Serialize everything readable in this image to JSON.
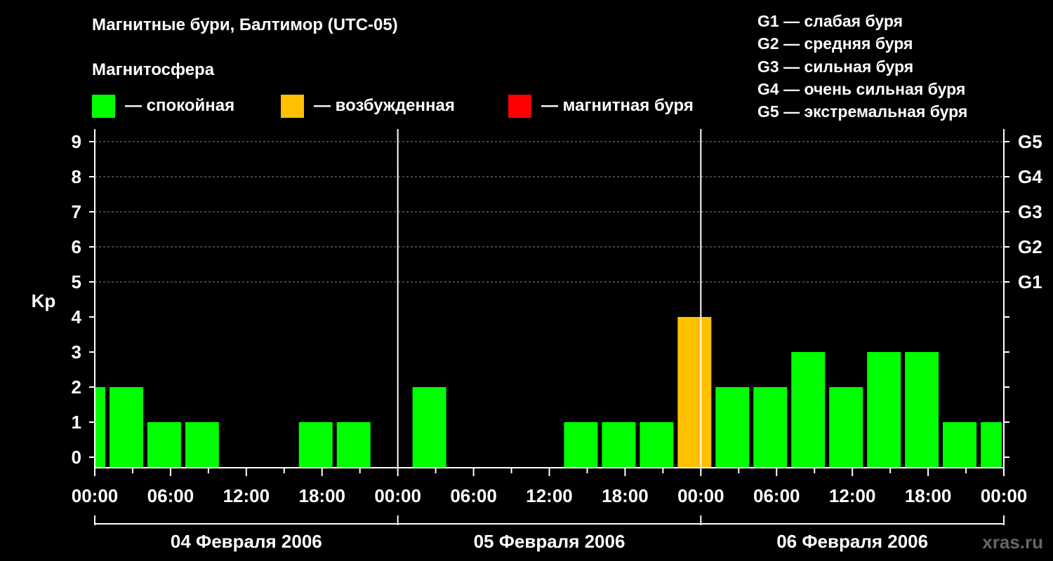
{
  "header": {
    "title": "Магнитные бури, Балтимор (UTC-05)",
    "subtitle": "Магнитосфера"
  },
  "legend": [
    {
      "label": "— спокойная",
      "color": "#00ff00"
    },
    {
      "label": "— возбужденная",
      "color": "#ffc000"
    },
    {
      "label": "— магнитная буря",
      "color": "#ff0000"
    }
  ],
  "g_scale": [
    "G1 — слабая буря",
    "G2 — средняя буря",
    "G3 — сильная буря",
    "G4 — очень сильная буря",
    "G5 — экстремальная буря"
  ],
  "watermark": "xras.ru",
  "chart_data": {
    "type": "bar",
    "title": "Магнитные бури, Балтимор (UTC-05)",
    "ylabel": "Kp",
    "ylim": [
      0,
      9
    ],
    "yticks": [
      0,
      1,
      2,
      3,
      4,
      5,
      6,
      7,
      8,
      9
    ],
    "right_ticks": [
      {
        "y": 5,
        "label": "G1"
      },
      {
        "y": 6,
        "label": "G2"
      },
      {
        "y": 7,
        "label": "G3"
      },
      {
        "y": 8,
        "label": "G4"
      },
      {
        "y": 9,
        "label": "G5"
      }
    ],
    "grid": "horizontal dashed at Kp 5–9",
    "x_range_hours": [
      0,
      72
    ],
    "x_tick_labels": [
      "00:00",
      "06:00",
      "12:00",
      "18:00",
      "00:00",
      "06:00",
      "12:00",
      "18:00",
      "00:00",
      "06:00",
      "12:00",
      "18:00",
      "00:00"
    ],
    "days": [
      "04 Февраля 2006",
      "05 Февраля 2006",
      "06 Февраля 2006"
    ],
    "colors": {
      "quiet": "#00ff00",
      "active": "#ffc000",
      "storm": "#ff0000"
    },
    "bars": [
      {
        "start": 0,
        "end": 1,
        "kp": 2,
        "state": "quiet"
      },
      {
        "start": 1,
        "end": 4,
        "kp": 2,
        "state": "quiet"
      },
      {
        "start": 4,
        "end": 7,
        "kp": 1,
        "state": "quiet"
      },
      {
        "start": 7,
        "end": 10,
        "kp": 1,
        "state": "quiet"
      },
      {
        "start": 10,
        "end": 13,
        "kp": 0,
        "state": "quiet"
      },
      {
        "start": 13,
        "end": 16,
        "kp": 0,
        "state": "quiet"
      },
      {
        "start": 16,
        "end": 19,
        "kp": 1,
        "state": "quiet"
      },
      {
        "start": 19,
        "end": 22,
        "kp": 1,
        "state": "quiet"
      },
      {
        "start": 22,
        "end": 25,
        "kp": 0,
        "state": "quiet"
      },
      {
        "start": 25,
        "end": 28,
        "kp": 2,
        "state": "quiet"
      },
      {
        "start": 28,
        "end": 31,
        "kp": 0,
        "state": "quiet"
      },
      {
        "start": 31,
        "end": 34,
        "kp": 0,
        "state": "quiet"
      },
      {
        "start": 34,
        "end": 37,
        "kp": 0,
        "state": "quiet"
      },
      {
        "start": 37,
        "end": 40,
        "kp": 1,
        "state": "quiet"
      },
      {
        "start": 40,
        "end": 43,
        "kp": 1,
        "state": "quiet"
      },
      {
        "start": 43,
        "end": 46,
        "kp": 1,
        "state": "quiet"
      },
      {
        "start": 46,
        "end": 49,
        "kp": 4,
        "state": "active"
      },
      {
        "start": 49,
        "end": 52,
        "kp": 2,
        "state": "quiet"
      },
      {
        "start": 52,
        "end": 55,
        "kp": 2,
        "state": "quiet"
      },
      {
        "start": 55,
        "end": 58,
        "kp": 3,
        "state": "quiet"
      },
      {
        "start": 58,
        "end": 61,
        "kp": 2,
        "state": "quiet"
      },
      {
        "start": 61,
        "end": 64,
        "kp": 3,
        "state": "quiet"
      },
      {
        "start": 64,
        "end": 67,
        "kp": 3,
        "state": "quiet"
      },
      {
        "start": 67,
        "end": 70,
        "kp": 1,
        "state": "quiet"
      },
      {
        "start": 70,
        "end": 72,
        "kp": 1,
        "state": "quiet"
      }
    ]
  }
}
